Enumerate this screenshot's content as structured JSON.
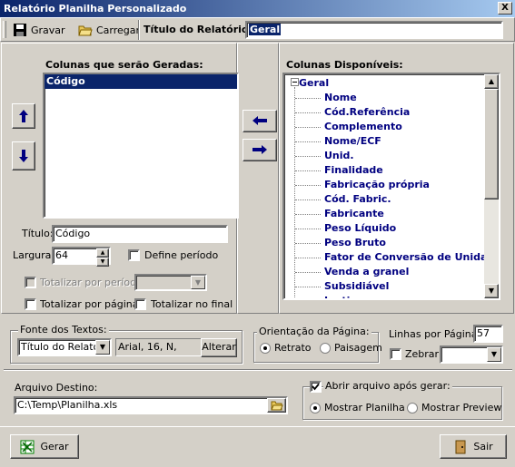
{
  "window": {
    "title": "Relatório Planilha Personalizado",
    "close": "X"
  },
  "toolbar": {
    "save_label": "Gravar",
    "load_label": "Carregar",
    "report_title_label": "Título do Relatório:",
    "report_title_value": "Geral"
  },
  "selected_columns": {
    "heading": "Colunas que serão Geradas:",
    "items": [
      "Código"
    ]
  },
  "available_columns": {
    "heading": "Colunas Disponíveis:",
    "root": "Geral",
    "items": [
      "Nome",
      "Cód.Referência",
      "Complemento",
      "Nome/ECF",
      "Unid.",
      "Finalidade",
      "Fabricação própria",
      "Cód. Fabric.",
      "Fabricante",
      "Peso Líquido",
      "Peso Bruto",
      "Fator de Conversão de Unidade",
      "Venda a granel",
      "Subsidiável",
      "Inativo"
    ]
  },
  "column_props": {
    "title_label": "Título:",
    "title_value": "Código",
    "width_label": "Largura:",
    "width_value": "64",
    "define_period": "Define período",
    "total_period": "Totalizar por período:",
    "total_page": "Totalizar por página",
    "total_end": "Totalizar no final"
  },
  "font_group": {
    "legend": "Fonte dos Textos:",
    "target": "Título do Relatório",
    "font_desc": "Arial, 16, N,",
    "change_label": "Alterar"
  },
  "orientation_group": {
    "legend": "Orientação da Página:",
    "portrait": "Retrato",
    "landscape": "Paisagem"
  },
  "lines": {
    "label": "Linhas por Página:",
    "value": "57",
    "zebra": "Zebrar:"
  },
  "destination": {
    "label": "Arquivo Destino:",
    "value": "C:\\Temp\\Planilha.xls"
  },
  "open_group": {
    "legend": "Abrir arquivo após gerar:",
    "show_sheet": "Mostrar Planilha",
    "show_preview": "Mostrar Preview"
  },
  "footer": {
    "generate_label": "Gerar",
    "exit_label": "Sair"
  },
  "colors": {
    "selection": "#0a246a",
    "tree_text": "#000080",
    "titlebar_start": "#0a246a",
    "titlebar_end": "#a6caf0"
  }
}
